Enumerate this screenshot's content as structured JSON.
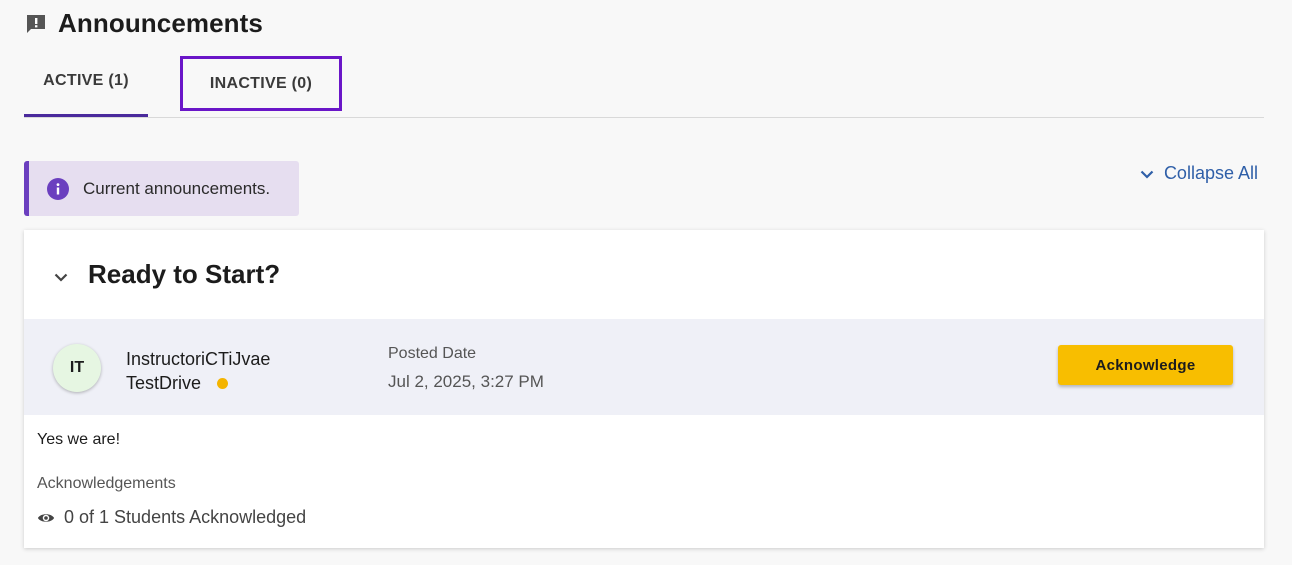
{
  "header": {
    "title": "Announcements",
    "icon": "announcement-icon"
  },
  "tabs": [
    {
      "label": "ACTIVE (1)",
      "selected": true
    },
    {
      "label": "INACTIVE (0)",
      "selected": false
    }
  ],
  "info_banner": {
    "icon": "info-icon",
    "text": "Current announcements."
  },
  "collapse_all": {
    "label": "Collapse All",
    "icon": "chevron-down-icon"
  },
  "announcement": {
    "title": "Ready to Start?",
    "expanded": true,
    "author": {
      "initials": "IT",
      "name_line1": "InstructoriCTiJvae",
      "name_line2": "TestDrive",
      "status_color": "#f4b400"
    },
    "posted_label": "Posted Date",
    "posted_date": "Jul 2, 2025, 3:27 PM",
    "action_label": "Acknowledge",
    "body": "Yes we are!",
    "acknowledgements_label": "Acknowledgements",
    "acknowledgements_count": "0 of 1 Students Acknowledged"
  },
  "colors": {
    "accent": "#4a2a9c",
    "focus_outline": "#6a16c8",
    "link": "#2f5fa8",
    "button": "#f8be00",
    "banner_bg": "#e6def0"
  }
}
